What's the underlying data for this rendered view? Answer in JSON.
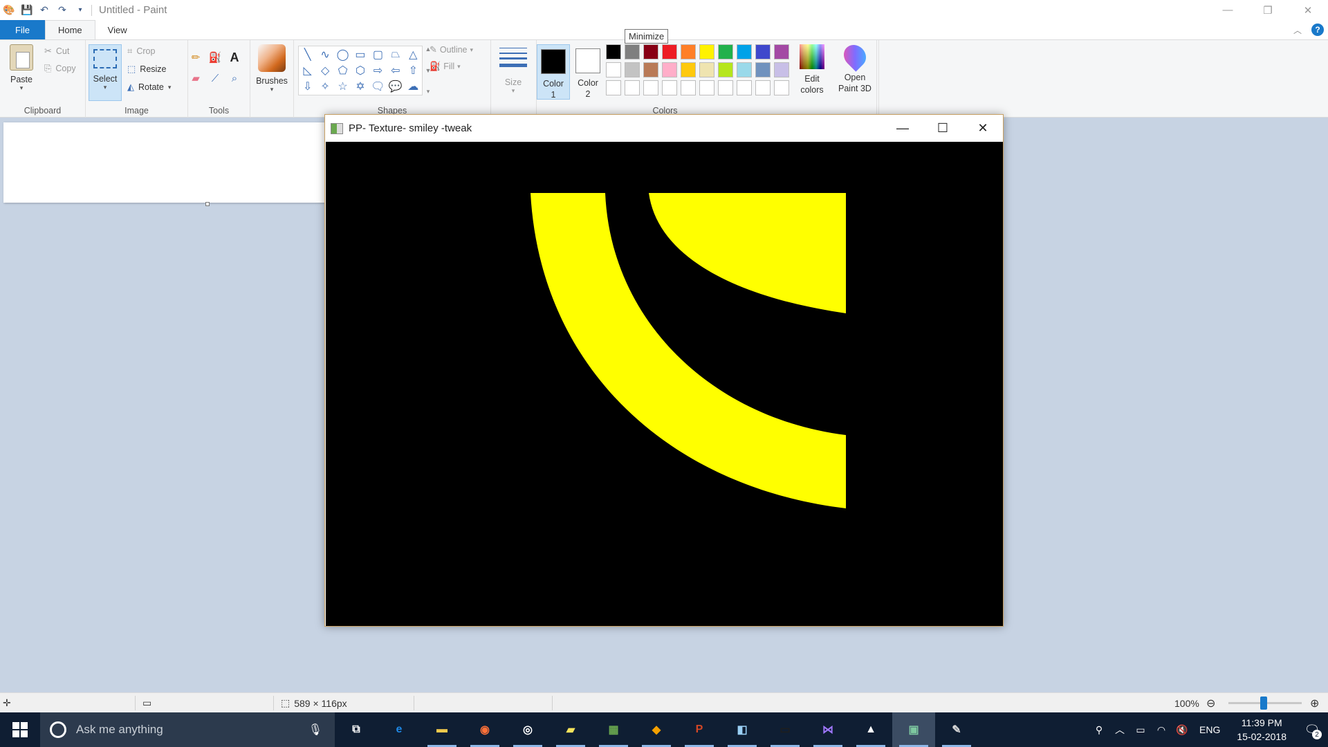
{
  "window": {
    "title": "Untitled - Paint",
    "quick_access_icons": [
      "paint-app-icon",
      "save-icon",
      "undo-icon",
      "redo-icon",
      "customize-toolbar-icon"
    ]
  },
  "tabs": [
    {
      "label": "File"
    },
    {
      "label": "Home"
    },
    {
      "label": "View"
    }
  ],
  "ribbon": {
    "clipboard": {
      "label": "Clipboard",
      "paste": "Paste",
      "cut": "Cut",
      "copy": "Copy"
    },
    "image": {
      "label": "Image",
      "select": "Select",
      "crop": "Crop",
      "resize": "Resize",
      "rotate": "Rotate"
    },
    "tools": {
      "label": "Tools",
      "items": [
        "pencil-icon",
        "fill-icon",
        "text-icon",
        "eraser-icon",
        "color-picker-icon",
        "magnifier-icon"
      ]
    },
    "brushes": {
      "label": "Brushes"
    },
    "shapes": {
      "label": "Shapes",
      "outline": "Outline",
      "fill": "Fill"
    },
    "size": {
      "label": "Size"
    },
    "colors": {
      "label": "Colors",
      "color1": {
        "line1": "Color",
        "line2": "1",
        "value": "#000000"
      },
      "color2": {
        "line1": "Color",
        "line2": "2",
        "value": "#ffffff"
      },
      "palette": [
        "#000000",
        "#7f7f7f",
        "#880015",
        "#ed1c24",
        "#ff7f27",
        "#fff200",
        "#22b14c",
        "#00a2e8",
        "#3f48cc",
        "#a349a4",
        "#ffffff",
        "#c3c3c3",
        "#b97a57",
        "#ffaec9",
        "#ffc90e",
        "#efe4b0",
        "#b5e61d",
        "#99d9ea",
        "#7092be",
        "#c8bfe7",
        "#ffffff",
        "#ffffff",
        "#ffffff",
        "#ffffff",
        "#ffffff",
        "#ffffff",
        "#ffffff",
        "#ffffff",
        "#ffffff",
        "#ffffff"
      ],
      "edit_colors_line1": "Edit",
      "edit_colors_line2": "colors",
      "open_paint3d_line1": "Open",
      "open_paint3d_line2": "Paint 3D"
    }
  },
  "tooltip": "Minimize",
  "floating_window": {
    "title": "PP- Texture- smiley -tweak",
    "image": {
      "background": "#000000",
      "shape_color": "#ffff00"
    }
  },
  "statusbar": {
    "selection_size": "589 × 116px",
    "zoom": "100%",
    "zoom_percent": 100
  },
  "taskbar": {
    "search_placeholder": "Ask me anything",
    "apps": [
      {
        "name": "task-view-icon",
        "glyph": "⧉",
        "color": "#ffffff"
      },
      {
        "name": "edge-icon",
        "glyph": "e",
        "color": "#1e88e5"
      },
      {
        "name": "file-explorer-icon",
        "glyph": "▬",
        "color": "#f2c94c"
      },
      {
        "name": "firefox-icon",
        "glyph": "◉",
        "color": "#ff7139"
      },
      {
        "name": "media-player-icon",
        "glyph": "◎",
        "color": "#ffffff"
      },
      {
        "name": "sticky-notes-icon",
        "glyph": "▰",
        "color": "#f8e45c"
      },
      {
        "name": "spreadsheet-app-icon",
        "glyph": "▦",
        "color": "#6aa84f"
      },
      {
        "name": "git-app-icon",
        "glyph": "◆",
        "color": "#f4a000"
      },
      {
        "name": "powerpoint-icon",
        "glyph": "P",
        "color": "#d24726"
      },
      {
        "name": "document-app-icon",
        "glyph": "◧",
        "color": "#9ad0f5"
      },
      {
        "name": "terminal-icon",
        "glyph": "▭",
        "color": "#1e1e1e"
      },
      {
        "name": "visual-studio-icon",
        "glyph": "⋈",
        "color": "#a077ff"
      },
      {
        "name": "photos-icon",
        "glyph": "▲",
        "color": "#ffffff"
      },
      {
        "name": "active-window-icon",
        "glyph": "▣",
        "color": "#7ec8a0"
      },
      {
        "name": "paint-icon",
        "glyph": "✎",
        "color": "#d7d7d7"
      }
    ],
    "language": "ENG",
    "time": "11:39 PM",
    "date": "15-02-2018",
    "notification_count": "2"
  }
}
